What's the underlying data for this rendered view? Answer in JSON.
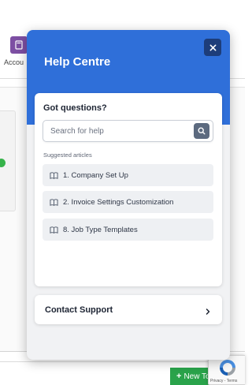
{
  "background": {
    "nav_label": "Accou",
    "nav_icon": "calculator-icon",
    "new_button_label": "New To",
    "recaptcha_text": "Privacy - Terms"
  },
  "help_centre": {
    "title": "Help Centre",
    "close_icon": "close-icon",
    "questions_title": "Got questions?",
    "search": {
      "placeholder": "Search for help",
      "value": "",
      "icon": "search-icon"
    },
    "suggested_label": "Suggested articles",
    "articles": [
      {
        "label": "1. Company Set Up",
        "icon": "book-icon"
      },
      {
        "label": "2. Invoice Settings Customization",
        "icon": "book-icon"
      },
      {
        "label": "8. Job Type Templates",
        "icon": "book-icon"
      }
    ],
    "contact": {
      "label": "Contact Support",
      "icon": "chevron-right-icon"
    }
  },
  "colors": {
    "header_blue": "#2f6fd9",
    "close_button": "#1d3d7a",
    "search_button": "#5c6a7f",
    "article_bg": "#eef0f3",
    "new_button_green": "#2aa34b",
    "nav_icon_purple": "#7d4fa3"
  }
}
